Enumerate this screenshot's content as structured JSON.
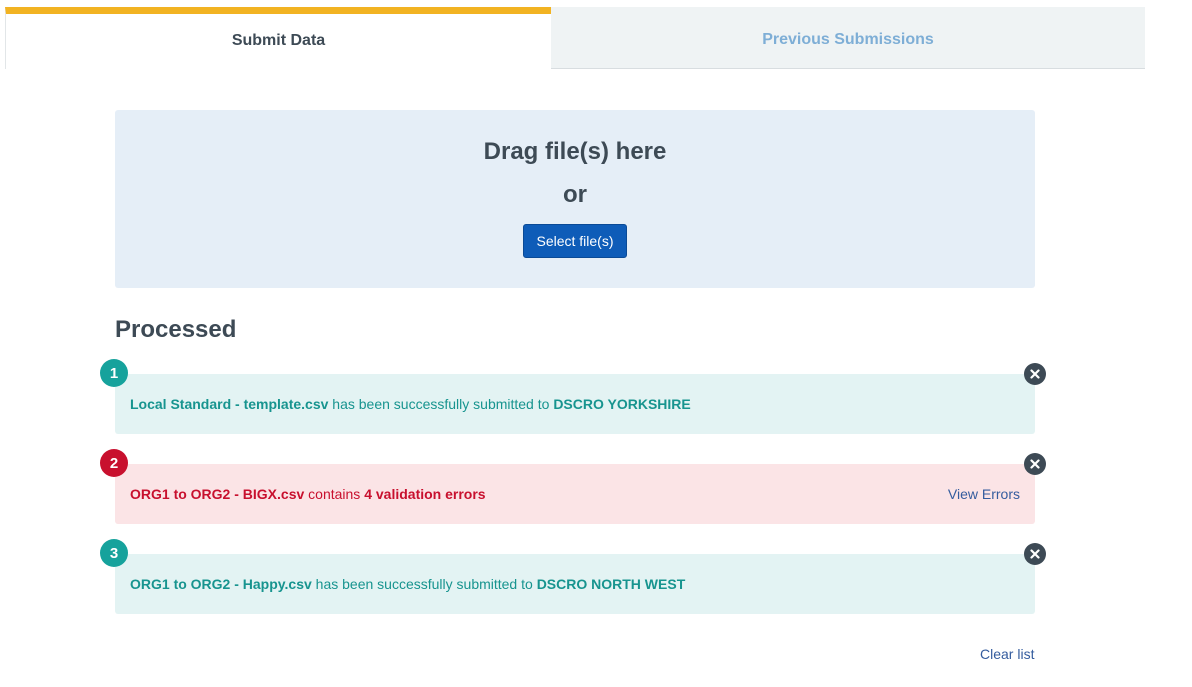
{
  "tabs": [
    {
      "label": "Submit Data",
      "active": true
    },
    {
      "label": "Previous Submissions",
      "active": false
    }
  ],
  "dropzone": {
    "title": "Drag file(s) here",
    "or": "or",
    "button_label": "Select file(s)"
  },
  "processed": {
    "title": "Processed",
    "items": [
      {
        "number": "1",
        "status": "success",
        "file": "Local Standard - template.csv",
        "middle": "has been successfully submitted to",
        "target": "DSCRO YORKSHIRE"
      },
      {
        "number": "2",
        "status": "error",
        "file": "ORG1 to ORG2 - BIGX.csv",
        "middle": "contains",
        "target": "4 validation errors",
        "action": "View Errors"
      },
      {
        "number": "3",
        "status": "success",
        "file": "ORG1 to ORG2 - Happy.csv",
        "middle": "has been successfully submitted to",
        "target": "DSCRO NORTH WEST"
      }
    ],
    "clear_label": "Clear list"
  },
  "colors": {
    "tab_accent": "#f2b322",
    "primary_button": "#0e5cb8",
    "success": "#16a29c",
    "error": "#c8102e"
  },
  "icons": {
    "close": "close-circle-icon"
  }
}
